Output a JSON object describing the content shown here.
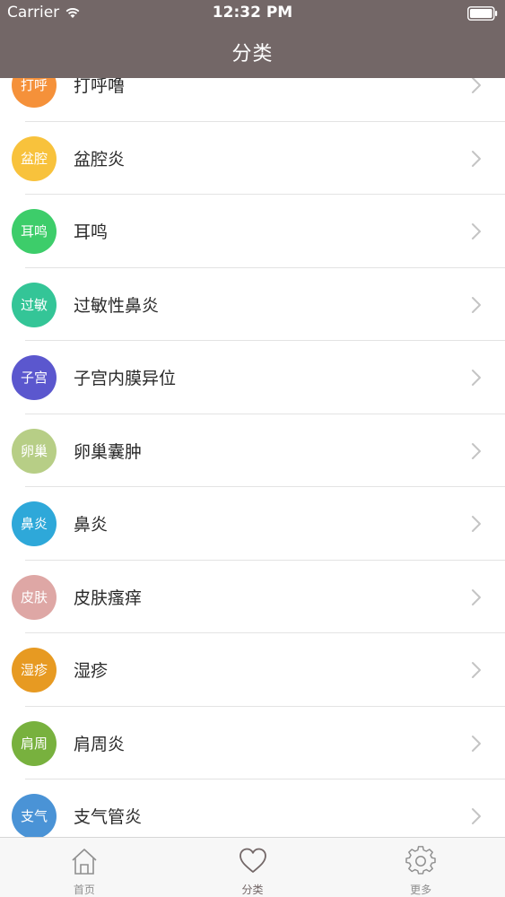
{
  "status_bar": {
    "carrier": "Carrier",
    "time": "12:32 PM"
  },
  "nav": {
    "title": "分类"
  },
  "list": [
    {
      "badge": "打呼",
      "label": "打呼噜",
      "color": "#F5913A"
    },
    {
      "badge": "盆腔",
      "label": "盆腔炎",
      "color": "#F8C23C"
    },
    {
      "badge": "耳鸣",
      "label": "耳鸣",
      "color": "#3DCD6A"
    },
    {
      "badge": "过敏",
      "label": "过敏性鼻炎",
      "color": "#34C597"
    },
    {
      "badge": "子宫",
      "label": "子宫内膜异位",
      "color": "#5B57CE"
    },
    {
      "badge": "卵巢",
      "label": "卵巢囊肿",
      "color": "#B7CE86"
    },
    {
      "badge": "鼻炎",
      "label": "鼻炎",
      "color": "#2EA8D9"
    },
    {
      "badge": "皮肤",
      "label": "皮肤瘙痒",
      "color": "#DEA7A5"
    },
    {
      "badge": "湿疹",
      "label": "湿疹",
      "color": "#E79A22"
    },
    {
      "badge": "肩周",
      "label": "肩周炎",
      "color": "#78B13E"
    },
    {
      "badge": "支气",
      "label": "支气管炎",
      "color": "#4A93D6"
    }
  ],
  "tabs": [
    {
      "label": "首页",
      "icon": "home-icon",
      "active": false
    },
    {
      "label": "分类",
      "icon": "heart-icon",
      "active": true
    },
    {
      "label": "更多",
      "icon": "gear-icon",
      "active": false
    }
  ],
  "colors": {
    "header_bg": "#736767",
    "tab_active": "#736767",
    "tab_inactive": "#8F8F8F"
  }
}
